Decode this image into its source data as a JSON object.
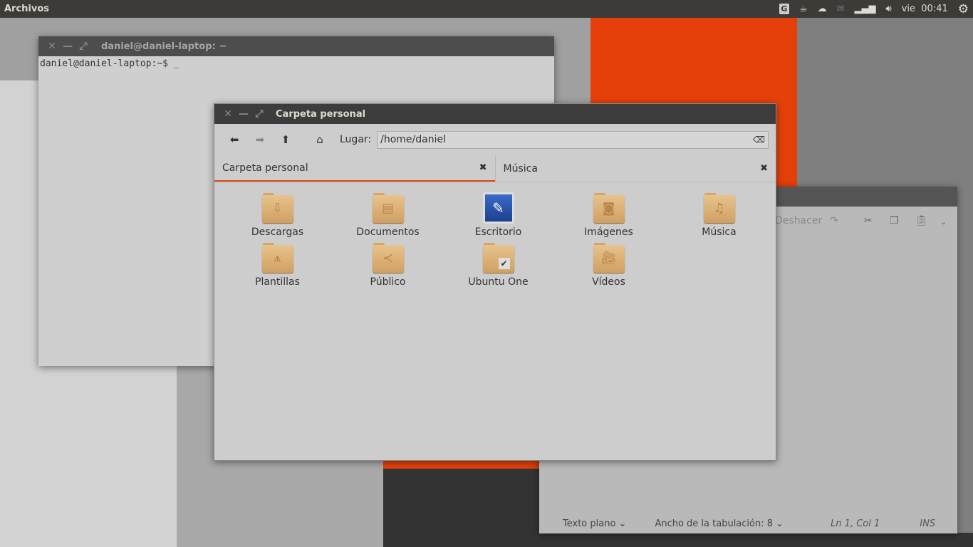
{
  "panel": {
    "title": "Archivos",
    "indicators": [
      "G",
      "coffee-icon",
      "cloud-icon",
      "mail-icon",
      "network-icon",
      "volume-icon"
    ],
    "day": "vie",
    "time": "00:41"
  },
  "terminal": {
    "title": "daniel@daniel-laptop: ~",
    "prompt": "daniel@daniel-laptop:~$ _"
  },
  "file_manager": {
    "title": "Carpeta personal",
    "location_label": "Lugar:",
    "location_value": "/home/daniel",
    "tabs": [
      {
        "label": "Carpeta personal",
        "active": true
      },
      {
        "label": "Música",
        "active": false
      }
    ],
    "items": [
      {
        "label": "Descargas",
        "icon": "download"
      },
      {
        "label": "Documentos",
        "icon": "document"
      },
      {
        "label": "Escritorio",
        "icon": "desktop"
      },
      {
        "label": "Imágenes",
        "icon": "camera"
      },
      {
        "label": "Música",
        "icon": "music"
      },
      {
        "label": "Plantillas",
        "icon": "compass"
      },
      {
        "label": "Público",
        "icon": "share"
      },
      {
        "label": "Ubuntu One",
        "icon": "check"
      },
      {
        "label": "Vídeos",
        "icon": "film"
      }
    ]
  },
  "editor": {
    "undo_label": "Deshacer",
    "language": "Texto plano",
    "tab_width_label": "Ancho de la tabulación:",
    "tab_width": "8",
    "position": "Ln 1, Col 1",
    "mode": "INS"
  },
  "colors": {
    "accent": "#dd4814",
    "panel": "#3c3b37"
  }
}
